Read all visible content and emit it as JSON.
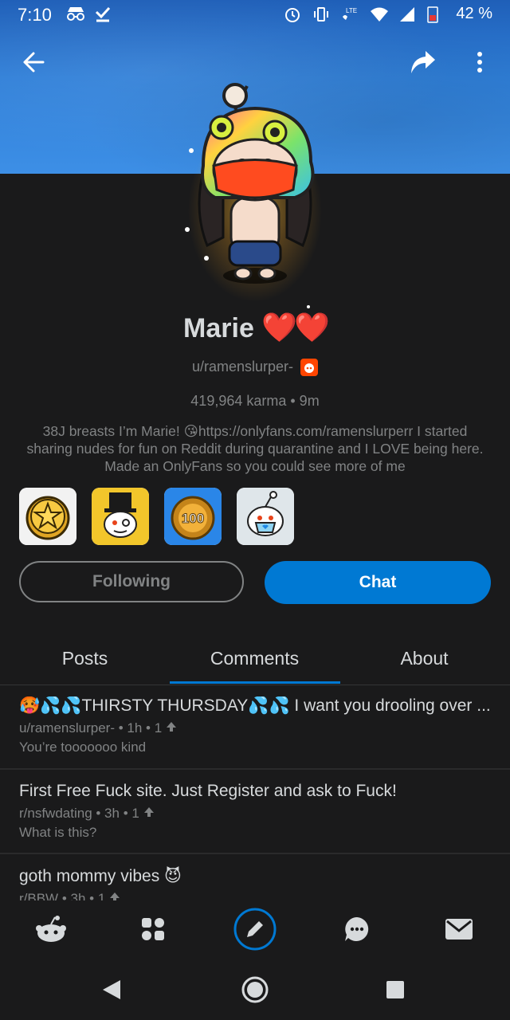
{
  "status_bar": {
    "time": "7:10",
    "battery_percent": "42 %",
    "network_label": "LTE",
    "left_icons": [
      "incognito-icon",
      "download-done-icon"
    ],
    "right_icons": [
      "alarm-icon",
      "vibrate-icon",
      "volte-icon",
      "wifi-icon",
      "signal-icon",
      "battery-icon"
    ]
  },
  "app_bar": {
    "back_icon": "arrow-left-icon",
    "share_icon": "share-icon",
    "more_icon": "more-vertical-icon"
  },
  "profile": {
    "display_name": "Marie",
    "name_emoji": "❤️❤️",
    "username": "u/ramenslurper-",
    "karma_line": "419,964 karma • 9m",
    "bio": "38J breasts I’m Marie! 😘https://onlyfans.com/ramenslurperr I started sharing nudes for fun on Reddit during quarantine and I LOVE being here. Made an OnlyFans so you could see more of me",
    "trophies": [
      "gold-star-coin-trophy",
      "top-hat-snoo-trophy",
      "100-medal-trophy",
      "masked-snoo-trophy"
    ],
    "following_label": "Following",
    "chat_label": "Chat",
    "accent_color": "#0079d3"
  },
  "tabs": [
    {
      "label": "Posts"
    },
    {
      "label": "Comments",
      "active": true
    },
    {
      "label": "About"
    }
  ],
  "comments": [
    {
      "title": "🥵💦💦THIRSTY THURSDAY💦💦 I want you drooling over ...",
      "meta": "u/ramenslurper- • 1h • 1",
      "body": "You’re tooooooo kind"
    },
    {
      "title": "First Free Fuck site. Just Register and ask to Fuck!",
      "meta": "r/nsfwdating • 3h • 1",
      "body": "What is this?"
    },
    {
      "title": "goth mommy vibes 😈",
      "meta": "r/BBW • 3h • 1",
      "body": ""
    }
  ],
  "bottom_nav": [
    "home-snoo-icon",
    "communities-icon",
    "create-post-icon",
    "chat-icon",
    "inbox-icon"
  ],
  "system_nav": [
    "back-triangle-icon",
    "home-circle-icon",
    "recents-square-icon"
  ]
}
